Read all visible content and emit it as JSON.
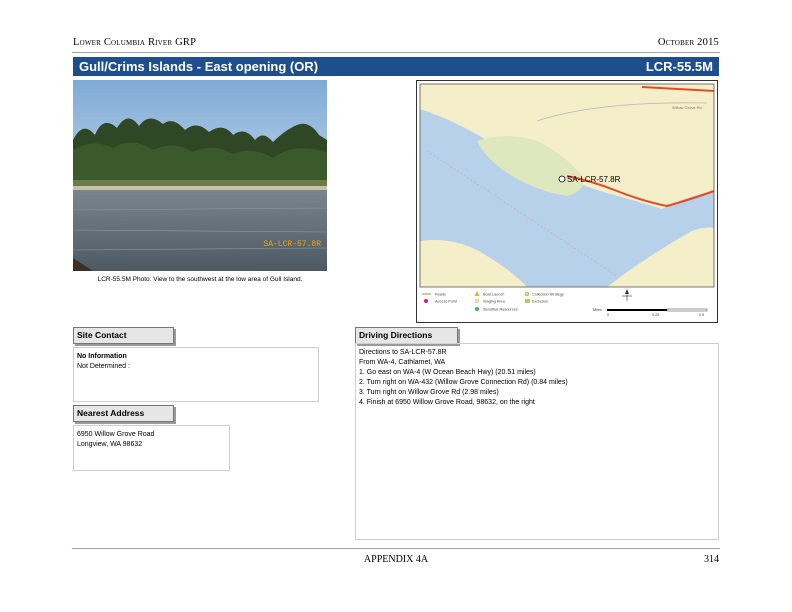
{
  "header": {
    "left": "Lower Columbia River GRP",
    "right": "October 2015"
  },
  "title": {
    "left": "Gull/Crims Islands - East opening (OR)",
    "right": "LCR-55.5M"
  },
  "photo": {
    "stamp": "SA-LCR-57.8R",
    "caption": "LCR-55.5M Photo: View to the southwest at the low area of Gull Island."
  },
  "map": {
    "site_label": "SA-LCR-57.8R",
    "road_label": "Willow Grove Rd",
    "scale_unit": "Miles",
    "scale_ticks": [
      "0",
      "0.25",
      "0.5"
    ],
    "legend": [
      {
        "label": "Roads",
        "icon": "line"
      },
      {
        "label": "Boat Launch",
        "icon": "triangle"
      },
      {
        "label": "Collection Strategy",
        "icon": "circle-dot"
      },
      {
        "label": "Access Point",
        "icon": "magenta-dot"
      },
      {
        "label": "Staging Area",
        "icon": "burst"
      },
      {
        "label": "Sensitive Resources",
        "icon": "green-dot"
      },
      {
        "label": "Exclusion",
        "icon": "green-square"
      }
    ],
    "colors": {
      "land": "#f5efc9",
      "water": "#b8d1ea",
      "island": "#dfe7bf",
      "road": "#e34a26"
    }
  },
  "site_contact": {
    "label": "Site Contact",
    "line1": "No Information",
    "line2": "Not Determined :"
  },
  "nearest_address": {
    "label": "Nearest Address",
    "line1": "6950 Willow Grove Road",
    "line2": "Longview, WA 98632"
  },
  "driving_directions": {
    "label": "Driving Directions",
    "lines": [
      "Directions to SA-LCR-57.8R",
      "From WA-4, Cathlamet, WA",
      "1. Go east on WA-4 (W Ocean Beach Hwy) (20.51 miles)",
      "2. Turn right on WA-432 (Willow Grove Connection Rd) (0.84 miles)",
      "3. Turn right on Willow Grove Rd (2.98 miles)",
      "4. Finish at 6950 Willow Grove Road, 98632, on the right"
    ]
  },
  "footer": {
    "center": "APPENDIX 4A",
    "page": "314"
  }
}
